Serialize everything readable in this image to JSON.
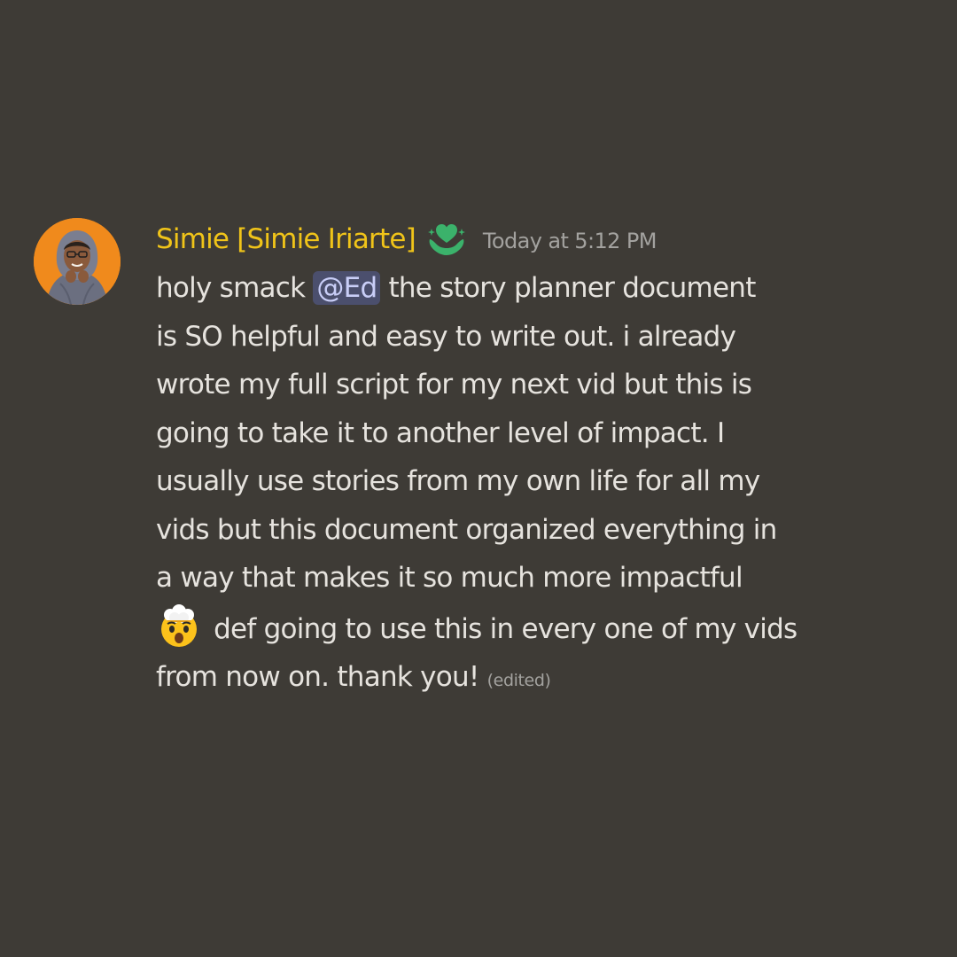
{
  "message": {
    "author_display": "Simie [Simie Iriarte]",
    "timestamp": "Today at 5:12 PM",
    "role_icon": "green-heart-hands-icon",
    "lines": {
      "l1_before": "holy smack ",
      "mention": "@Ed",
      "l1_after": " the story planner document",
      "l2": "is SO helpful and easy to write out. i already",
      "l3": "wrote my full script for my next vid but this is",
      "l4": "going to take it to another level of impact. I",
      "l5": "usually use stories from my own life for all my",
      "l6": "vids but this document organized everything in",
      "l7": "a way that makes it so much more impactful",
      "l8_emoji": "exploding-head-emoji",
      "l8": " def going to use this in every one of my vids",
      "l9": "from now on. thank you! "
    },
    "edited_label": "(edited)"
  },
  "colors": {
    "background": "#3e3b36",
    "username": "#f0c419",
    "text": "#e6e3de",
    "mention_bg": "#4b4f6d",
    "mention_text": "#c9cef7",
    "muted": "#a3a29f"
  }
}
